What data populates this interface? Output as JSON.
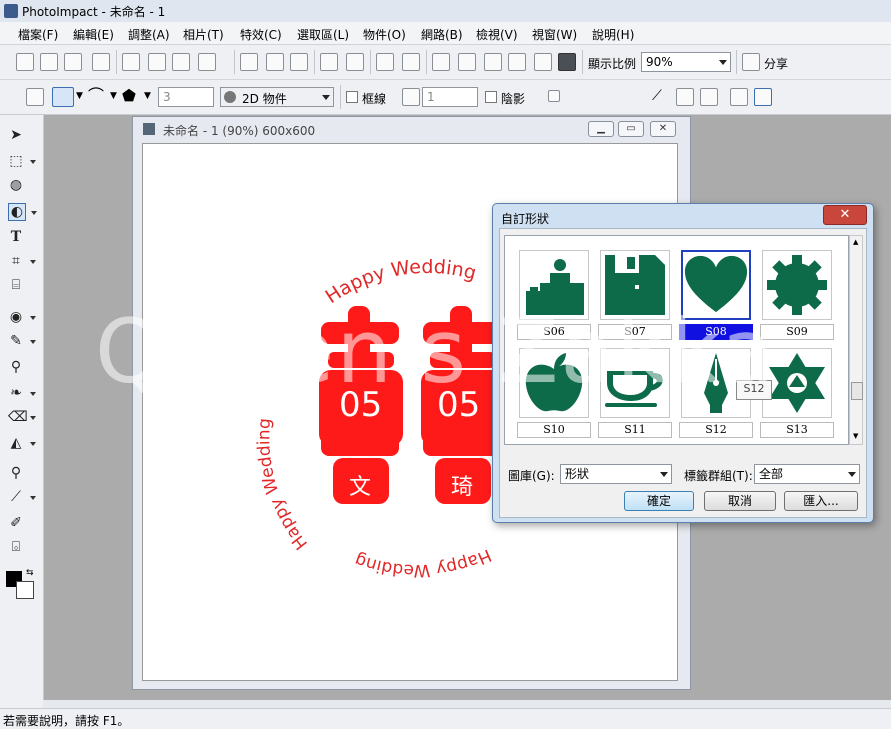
{
  "app": {
    "title": "PhotoImpact - 未命名 - 1"
  },
  "menu": [
    "檔案(F)",
    "編輯(E)",
    "調整(A)",
    "相片(T)",
    "特效(C)",
    "選取區(L)",
    "物件(O)",
    "網路(B)",
    "檢視(V)",
    "視窗(W)",
    "說明(H)"
  ],
  "toolbar1": {
    "zoom_label": "顯示比例",
    "zoom_value": "90%",
    "share_label": "分享"
  },
  "toolbar2": {
    "spin1": "3",
    "mode_value": "2D 物件",
    "border_label": "框線",
    "spin2": "1",
    "shadow_label": "陰影"
  },
  "document": {
    "title": "未命名 - 1 (90%) 600x600"
  },
  "artwork": {
    "arc_top": "Happy Wedding",
    "arc_left": "Happy Wedding",
    "arc_bottom": "Happy Wedding",
    "num_left": "05",
    "num_right": "05",
    "name_left": "文",
    "name_right": "琦",
    "main_color": "#ff1a1a",
    "arc_color": "#e02828"
  },
  "watermark": "Queen's Zakka",
  "dialog": {
    "title": "自訂形狀",
    "close_label": "✕",
    "shapes": [
      {
        "label": "S06",
        "icon": "person-at-desk-icon"
      },
      {
        "label": "S07",
        "icon": "floppy-disk-icon"
      },
      {
        "label": "S08",
        "icon": "heart-icon"
      },
      {
        "label": "S09",
        "icon": "gear-icon"
      },
      {
        "label": "S10",
        "icon": "apple-icon"
      },
      {
        "label": "S11",
        "icon": "teacup-icon"
      },
      {
        "label": "S12",
        "icon": "pen-nib-icon"
      },
      {
        "label": "S13",
        "icon": "star-of-david-icon"
      }
    ],
    "selected": "S08",
    "tooltip": "S12",
    "gallery_label": "圖庫(G):",
    "gallery_value": "形狀",
    "tag_label": "標籤群組(T):",
    "tag_value": "全部",
    "ok_label": "確定",
    "cancel_label": "取消",
    "import_label": "匯入...",
    "shape_color": "#0d6b4a"
  },
  "status": {
    "text": "若需要說明，請按 F1。"
  }
}
